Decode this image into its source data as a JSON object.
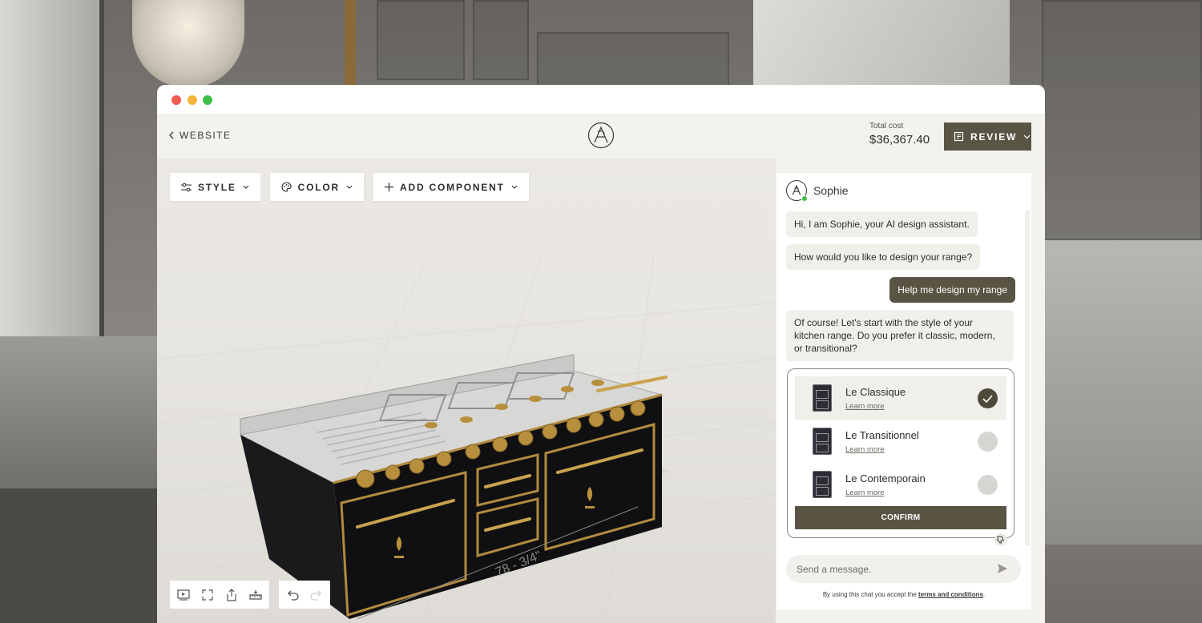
{
  "header": {
    "back_label": "WEBSITE",
    "total_label": "Total cost",
    "total_value": "$36,367.40",
    "review_label": "REVIEW"
  },
  "toolbar": {
    "style_label": "STYLE",
    "color_label": "COLOR",
    "add_component_label": "ADD COMPONENT"
  },
  "viewport": {
    "dimension_label": "78 - 3/4\""
  },
  "chat": {
    "assistant_name": "Sophie",
    "messages": [
      {
        "from": "assistant",
        "text": "Hi, I am Sophie, your AI design assistant."
      },
      {
        "from": "assistant",
        "text": "How would you like to design your range?"
      },
      {
        "from": "user",
        "text": "Help me design my range"
      },
      {
        "from": "assistant",
        "text": "Of course! Let's start with the style of your kitchen range. Do you prefer it classic, modern, or transitional?"
      }
    ],
    "options": [
      {
        "name": "Le Classique",
        "link": "Learn more",
        "selected": true
      },
      {
        "name": "Le Transitionnel",
        "link": "Learn more",
        "selected": false
      },
      {
        "name": "Le Contemporain",
        "link": "Learn more",
        "selected": false
      }
    ],
    "confirm_label": "CONFIRM",
    "input_placeholder": "Send a message.",
    "terms_prefix": "By using this chat you accept the",
    "terms_link": "terms and conditions",
    "terms_suffix": "."
  },
  "colors": {
    "accent": "#5a5444",
    "panel": "#ffffff",
    "app_bg": "#f3f2ee"
  },
  "icons": [
    "chevron-left-icon",
    "brand-logo-icon",
    "receipt-icon",
    "chevron-down-icon",
    "sliders-icon",
    "palette-icon",
    "plus-icon",
    "video-icon",
    "fullscreen-icon",
    "share-icon",
    "measure-icon",
    "undo-icon",
    "redo-icon",
    "check-icon",
    "thumbs-down-icon",
    "send-icon"
  ]
}
